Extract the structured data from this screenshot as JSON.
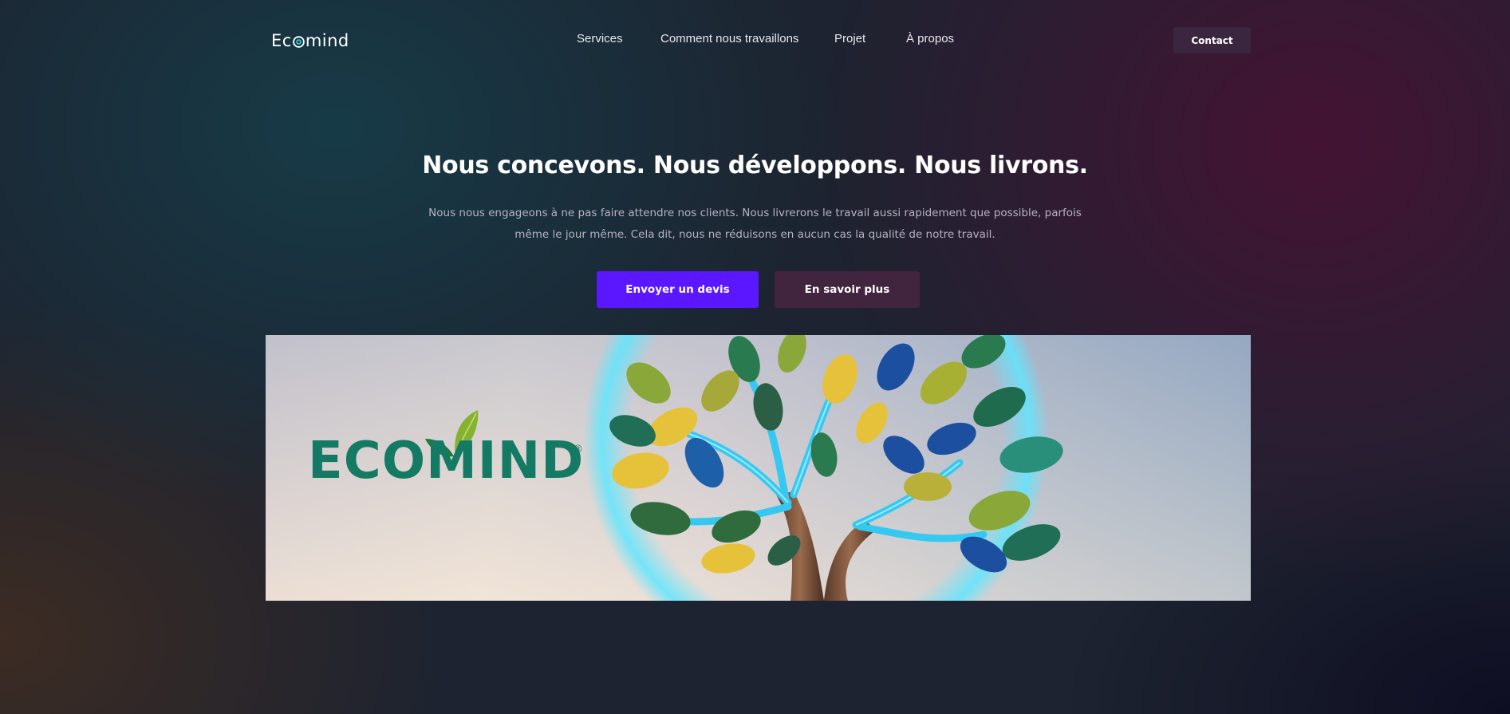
{
  "brand": {
    "name_start": "Ec",
    "name_end": "mind"
  },
  "nav": {
    "items": [
      {
        "label": "Services"
      },
      {
        "label": "Comment nous travaillons"
      },
      {
        "label": "Projet"
      },
      {
        "label": "À propos"
      }
    ],
    "contact_label": "Contact"
  },
  "hero": {
    "title": "Nous concevons. Nous développons. Nous livrons.",
    "description": "Nous nous engageons à ne pas faire attendre nos clients. Nous livrerons le travail aussi rapidement que possible, parfois même le jour même. Cela dit, nous ne réduisons en aucun cas la qualité de notre travail.",
    "primary_button": "Envoyer un devis",
    "secondary_button": "En savoir plus"
  },
  "banner": {
    "wordmark": "ECOMIND",
    "registered_mark": "®"
  },
  "colors": {
    "accent": "#5b17ff",
    "secondary_button": "#41253f",
    "contact_button": "#3b2640",
    "brand_green": "#147a64",
    "circuit_blue": "#2fc4f0"
  }
}
